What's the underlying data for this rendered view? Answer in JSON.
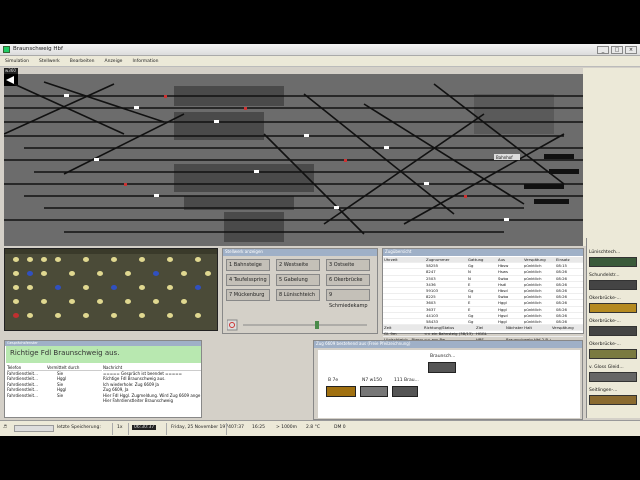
{
  "window": {
    "title": "Braunschweig Hbf"
  },
  "menu": [
    "Simulation",
    "Stellwerk",
    "Bearbeiten",
    "Anzeige",
    "Information"
  ],
  "track_view": {
    "title": "w360",
    "label": "Bahnhof"
  },
  "destination_panel": {
    "title": "Stellwerk anzeigen",
    "buttons": [
      "1 Bahnsteige",
      "2 Westseite",
      "3 Ostseite",
      "4 Teufelsspring",
      "5 Gabelung",
      "6 Okerbrücke",
      "7 Mückenburg",
      "8 Lünischteich",
      "9 Schmiedekamp"
    ]
  },
  "train_table": {
    "title": "Zugübersicht",
    "headers": [
      "Uhrzeit",
      "Zugnummer",
      "Gattung",
      "Aus",
      "Verspätung",
      "Einsatz"
    ],
    "rows": [
      [
        "",
        "58255",
        "Gg",
        "Hbsw",
        "pünktlich",
        "08:15"
      ],
      [
        "",
        "8247",
        "N",
        "Hsws",
        "pünktlich",
        "08:26"
      ],
      [
        "",
        "2503",
        "N",
        "Swba",
        "pünktlich",
        "08:26"
      ],
      [
        "",
        "3436",
        "E",
        "Hsdl",
        "pünktlich",
        "08:26"
      ],
      [
        "",
        "59103",
        "Gg",
        "Hbsd",
        "pünktlich",
        "08:26"
      ],
      [
        "",
        "8225",
        "N",
        "Swba",
        "pünktlich",
        "08:26"
      ],
      [
        "",
        "3603",
        "E",
        "Hggl",
        "pünktlich",
        "08:26"
      ],
      [
        "",
        "3637",
        "E",
        "Hggl",
        "pünktlich",
        "08:26"
      ],
      [
        "",
        "44103",
        "Gg",
        "Hgsd",
        "pünktlich",
        "08:26"
      ],
      [
        "",
        "58433",
        "Gg",
        "Hggl",
        "pünktlich",
        "08:26"
      ]
    ],
    "detail_headers": [
      "Zeit",
      "Richtung/Status",
      "Ziel",
      "Nächster Halt",
      "Verspätung"
    ],
    "detail_rows": [
      [
        "Gl. 9m",
        "<< ein Bahnsteig (38/13)",
        "HGGL",
        "",
        ""
      ],
      [
        "Lünischteich - Biesnw",
        "<< aus Bw",
        "HBS",
        "Braunschweig Hbf 2.B. 0",
        ""
      ]
    ]
  },
  "conversation": {
    "title": "Gesprächsfenster",
    "banner": "Richtige Fdl Braunschweig aus.",
    "headers": [
      "Telefon",
      "Vermittelt durch",
      "Nachricht"
    ],
    "callers": [
      [
        "Fahrdienstleit...",
        "Sie"
      ],
      [
        "Fahrdienstleit...",
        "Hggl"
      ],
      [
        "Fahrdienstleit...",
        "Sie"
      ],
      [
        "Fahrdienstleit...",
        "Hggl"
      ],
      [
        "Fahrdienstleit...",
        "Sie"
      ]
    ],
    "messages": [
      "===== Gespräch ist beendet =====",
      "Richtige Fdl Braunschweig aus.",
      "Ich wiederhole: Zug 6609 Ja",
      "Zug 6609, Ja",
      "Hier Fdl Hggl. Zugmeldung. Wird Zug 6609 ange",
      "Hier Fahrdienstleiter Braunschweig"
    ]
  },
  "formation": {
    "title": "Zug 6609 bestehend aus (Freie Pfeilzeichnung)",
    "vehicles": [
      {
        "label": "Braunsch...",
        "color": "#555"
      },
      {
        "label": "B 7e",
        "color": "#a07010"
      },
      {
        "label": "N7 w150",
        "color": "#777"
      },
      {
        "label": "111 Brau...",
        "color": "#555"
      }
    ]
  },
  "trainlist": {
    "items": [
      {
        "label": "Lünischtech...",
        "color": "#3a5a3a"
      },
      {
        "label": "Schundelstr...",
        "color": "#444"
      },
      {
        "label": "Okerbrücke-...",
        "color": "#b58a20"
      },
      {
        "label": "Okerbrücke-...",
        "color": "#444"
      },
      {
        "label": "Okerbrücke-...",
        "color": "#7a7a40"
      },
      {
        "label": "v. Gloss Gleid...",
        "color": "#666"
      },
      {
        "label": "Seitlingen-...",
        "color": "#8a6a30"
      }
    ]
  },
  "status": {
    "save": "letzte Speicherung:",
    "zoom": "1x",
    "mode": "06:30:37",
    "date": "Friday, 25 November 1974",
    "time": "07:37",
    "clock2": "16:25",
    "visibility": "> 1000m",
    "temp": "2.8 °C",
    "dm": "DM 0"
  }
}
